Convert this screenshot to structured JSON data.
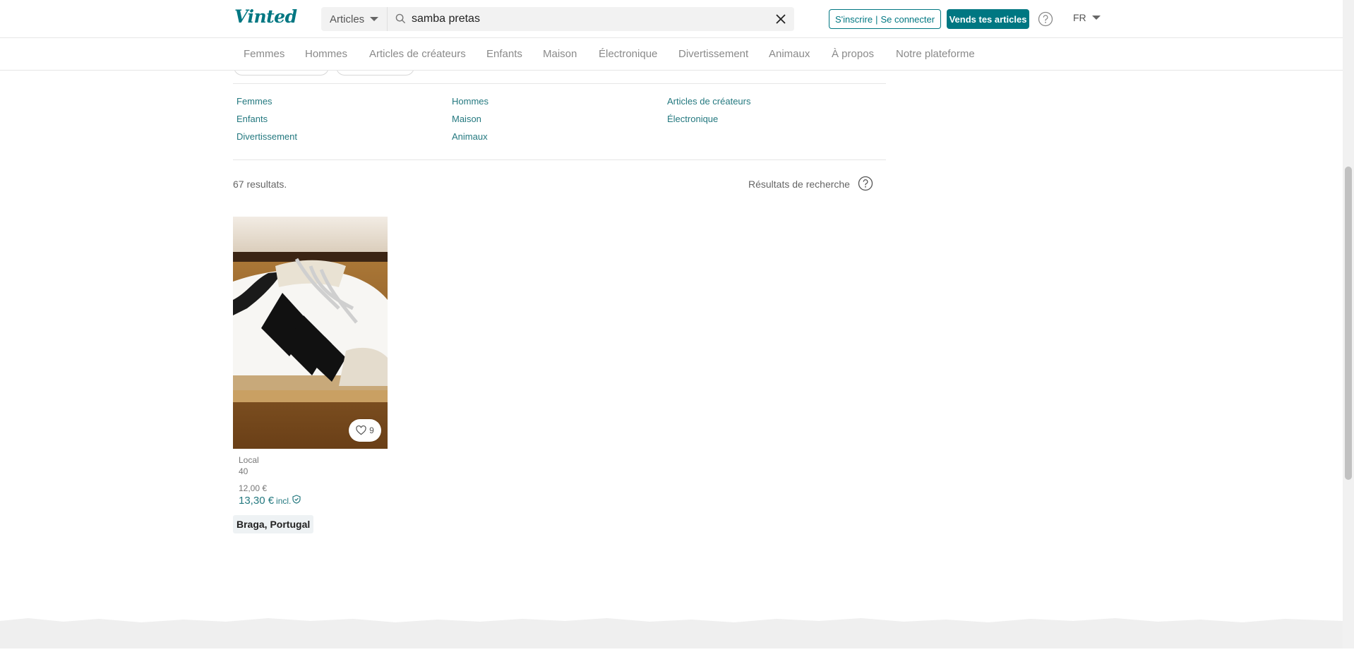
{
  "header": {
    "logo": "Vinted",
    "category_select": "Articles",
    "search_value": "samba pretas",
    "signup_label": "S'inscrire",
    "login_label": "Se connecter",
    "auth_separator": "|",
    "sell_label": "Vends tes articles",
    "language": "FR"
  },
  "catnav": [
    "Femmes",
    "Hommes",
    "Articles de créateurs",
    "Enfants",
    "Maison",
    "Électronique",
    "Divertissement",
    "Animaux",
    "À propos",
    "Notre plateforme"
  ],
  "category_links": [
    "Femmes",
    "Hommes",
    "Articles de créateurs",
    "Enfants",
    "Maison",
    "Électronique",
    "Divertissement",
    "Animaux"
  ],
  "results": {
    "count": "67 resultats.",
    "label": "Résultats de recherche"
  },
  "item": {
    "favorites": "9",
    "brand": "Local",
    "size": "40",
    "price": "12,00 €",
    "price_incl": "13,30 €",
    "incl_label": "incl.",
    "location": "Braga, Portugal"
  },
  "colors": {
    "brand": "#007782",
    "link": "#23787f"
  }
}
